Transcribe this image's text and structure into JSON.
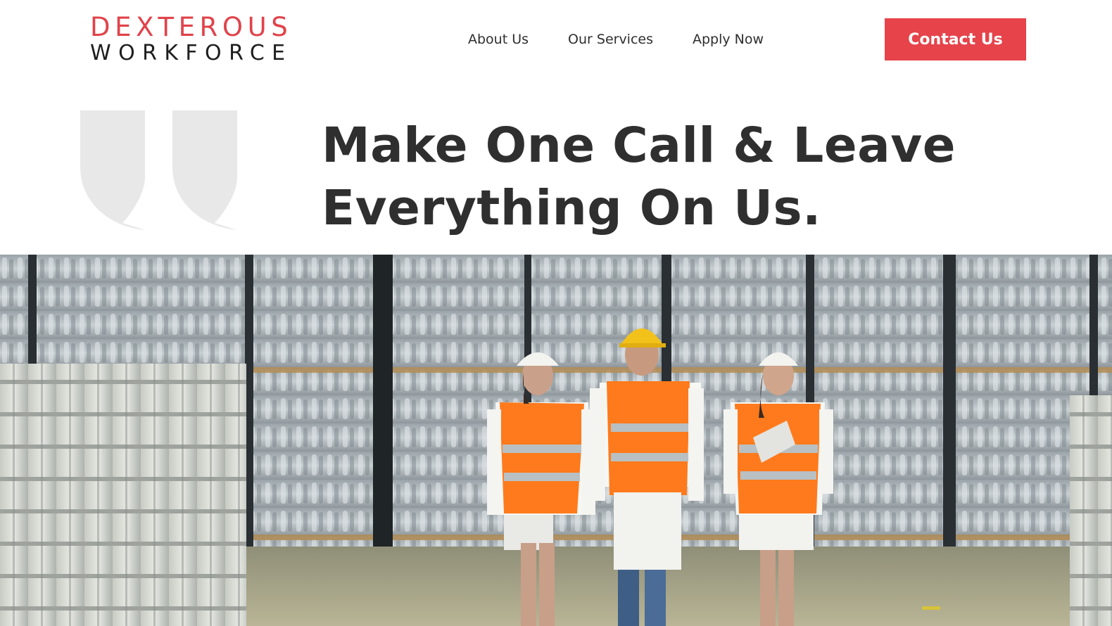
{
  "brand": {
    "name_top": "DEXTEROUS",
    "name_bottom": "WORKFORCE",
    "primary_color": "#e6434b",
    "text_color": "#1e1e1e"
  },
  "nav": {
    "items": [
      {
        "label": "About Us"
      },
      {
        "label": "Our Services"
      },
      {
        "label": "Apply Now"
      }
    ]
  },
  "cta": {
    "label": "Contact Us"
  },
  "hero": {
    "quote_icon": "double-quote-icon",
    "headline_line1": "Make One Call & Leave",
    "headline_line2": "Everything On Us.",
    "image": "warehouse-workers-photo"
  }
}
